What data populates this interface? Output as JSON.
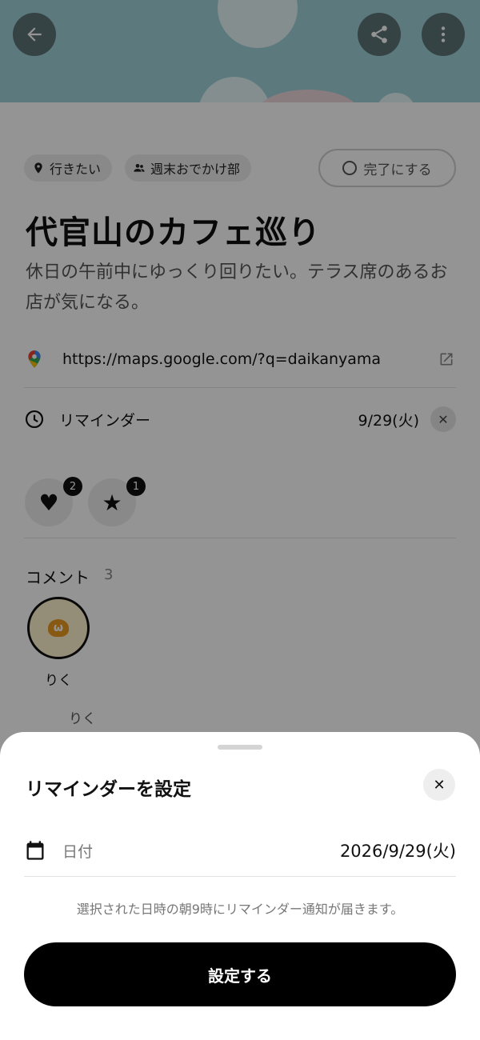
{
  "header": {
    "back_icon": "arrow-left-icon",
    "share_icon": "share-icon",
    "more_icon": "more-vertical-icon"
  },
  "tags": [
    {
      "icon": "location-pin-icon",
      "label": "行きたい"
    },
    {
      "icon": "group-icon",
      "label": "週末おでかけ部"
    }
  ],
  "status_button": {
    "icon": "circle-outline-icon",
    "label": "完了にする"
  },
  "item": {
    "title": "代官山のカフェ巡り",
    "description": "休日の午前中にゆっくり回りたい。テラス席のあるお店が気になる。"
  },
  "link": {
    "icon": "google-maps-icon",
    "url": "https://maps.google.com/?q=daikanyama",
    "open_icon": "external-link-icon"
  },
  "reminder": {
    "icon": "clock-icon",
    "label": "リマインダー",
    "date": "9/29(火)",
    "clear_icon": "close-icon"
  },
  "reactions": [
    {
      "icon": "heart-icon",
      "symbol": "♥",
      "count": "2"
    },
    {
      "icon": "star-icon",
      "symbol": "★",
      "count": "1"
    }
  ],
  "comments": {
    "label": "コメント",
    "count": "3",
    "avatar_name": "りく",
    "avatar_glyph": "ω",
    "author": "りく"
  },
  "sheet": {
    "title": "リマインダーを設定",
    "close_icon": "close-icon",
    "date_icon": "calendar-icon",
    "date_label": "日付",
    "date_value": "2026/9/29(火)",
    "note": "選択された日時の朝9時にリマインダー通知が届きます。",
    "submit_label": "設定する"
  },
  "colors": {
    "hero": "#9fd0d8",
    "scrim": "rgba(0,0,0,0.42)",
    "primary_button": "#000000"
  }
}
